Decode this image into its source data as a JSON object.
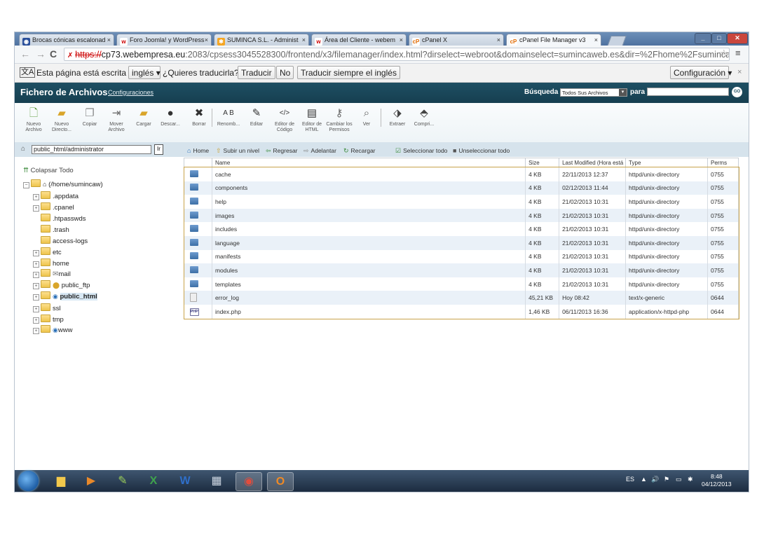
{
  "browser": {
    "tabs": [
      {
        "label": "Brocas cónicas escalonad",
        "favicon": "globe-icon"
      },
      {
        "label": "Foro Joomla! y WordPress",
        "favicon": "webempresa-icon"
      },
      {
        "label": "SUMINCA S.L. - Administ",
        "favicon": "joomla-icon"
      },
      {
        "label": "Área del Cliente - webem",
        "favicon": "webempresa-icon"
      },
      {
        "label": "cPanel X",
        "favicon": "cpanel-icon"
      },
      {
        "label": "cPanel File Manager v3",
        "favicon": "cpanel-icon"
      }
    ],
    "url_scheme": "https://",
    "url_host": "cp73.webempresa.eu",
    "url_rest": ":2083/cpsess3045528300/frontend/x3/filemanager/index.html?dirselect=webroot&domainselect=sumincaweb.es&dir=%2Fhome%2Fsumincaw%2Fpubl"
  },
  "translate": {
    "message": "Esta página está escrita en",
    "language": "inglés",
    "question": "¿Quieres traducirla?",
    "translate_btn": "Traducir",
    "no_btn": "No",
    "always_btn": "Traducir siempre el inglés",
    "settings_btn": "Configuración"
  },
  "cpanel": {
    "title": "Fichero de Archivos",
    "config_link": "Configuraciones",
    "search_label": "Búsqueda",
    "search_scope": "Todos Sus Archivos",
    "for_label": "para",
    "go_label": "GO"
  },
  "toolbar": [
    {
      "label": "Nuevo Archivo",
      "icon": "new-file-icon"
    },
    {
      "label": "Nuevo Directo...",
      "icon": "new-folder-icon"
    },
    {
      "label": "Copiar",
      "icon": "copy-icon"
    },
    {
      "label": "Mover Archivo",
      "icon": "move-file-icon"
    },
    {
      "label": "Cargar",
      "icon": "upload-icon"
    },
    {
      "label": "Descar...",
      "icon": "download-icon"
    },
    {
      "label": "Borrar",
      "icon": "delete-icon"
    },
    {
      "label": "Renomb...",
      "icon": "rename-icon"
    },
    {
      "label": "Editar",
      "icon": "edit-icon"
    },
    {
      "label": "Editor de Código",
      "icon": "code-editor-icon"
    },
    {
      "label": "Editor de HTML",
      "icon": "html-editor-icon"
    },
    {
      "label": "Cambiar los Permisos",
      "icon": "permissions-icon"
    },
    {
      "label": "Ver",
      "icon": "view-icon"
    },
    {
      "label": "Extraer",
      "icon": "extract-icon"
    },
    {
      "label": "Compri...",
      "icon": "compress-icon"
    }
  ],
  "left": {
    "path_value": "public_html/administrator",
    "go_label": "Ir",
    "collapse_label": "Colapsar Todo",
    "tree": [
      {
        "label": "(/home/sumincaw)"
      },
      {
        "label": ".appdata"
      },
      {
        "label": ".cpanel"
      },
      {
        "label": ".htpasswds"
      },
      {
        "label": ".trash"
      },
      {
        "label": "access-logs"
      },
      {
        "label": "etc"
      },
      {
        "label": "home"
      },
      {
        "label": "mail"
      },
      {
        "label": "public_ftp"
      },
      {
        "label": "public_html"
      },
      {
        "label": "ssl"
      },
      {
        "label": "tmp"
      },
      {
        "label": "www"
      }
    ]
  },
  "rightnav": {
    "home": "Home",
    "up": "Subir un nivel",
    "back": "Regresar",
    "forward": "Adelantar",
    "reload": "Recargar",
    "select_all": "Seleccionar todo",
    "unselect_all": "Unseleccionar todo"
  },
  "table": {
    "headers": [
      "Name",
      "Size",
      "Last Modified (Hora está",
      "Type",
      "Perms"
    ],
    "rows": [
      {
        "icon": "folder",
        "name": "cache",
        "size": "4 KB",
        "modified": "22/11/2013 12:37",
        "type": "httpd/unix-directory",
        "perms": "0755"
      },
      {
        "icon": "folder",
        "name": "components",
        "size": "4 KB",
        "modified": "02/12/2013 11:44",
        "type": "httpd/unix-directory",
        "perms": "0755"
      },
      {
        "icon": "folder",
        "name": "help",
        "size": "4 KB",
        "modified": "21/02/2013 10:31",
        "type": "httpd/unix-directory",
        "perms": "0755"
      },
      {
        "icon": "folder",
        "name": "images",
        "size": "4 KB",
        "modified": "21/02/2013 10:31",
        "type": "httpd/unix-directory",
        "perms": "0755"
      },
      {
        "icon": "folder",
        "name": "includes",
        "size": "4 KB",
        "modified": "21/02/2013 10:31",
        "type": "httpd/unix-directory",
        "perms": "0755"
      },
      {
        "icon": "folder",
        "name": "language",
        "size": "4 KB",
        "modified": "21/02/2013 10:31",
        "type": "httpd/unix-directory",
        "perms": "0755"
      },
      {
        "icon": "folder",
        "name": "manifests",
        "size": "4 KB",
        "modified": "21/02/2013 10:31",
        "type": "httpd/unix-directory",
        "perms": "0755"
      },
      {
        "icon": "folder",
        "name": "modules",
        "size": "4 KB",
        "modified": "21/02/2013 10:31",
        "type": "httpd/unix-directory",
        "perms": "0755"
      },
      {
        "icon": "folder",
        "name": "templates",
        "size": "4 KB",
        "modified": "21/02/2013 10:31",
        "type": "httpd/unix-directory",
        "perms": "0755"
      },
      {
        "icon": "text",
        "name": "error_log",
        "size": "45,21 KB",
        "modified": "Hoy 08:42",
        "type": "text/x-generic",
        "perms": "0644"
      },
      {
        "icon": "php",
        "name": "index.php",
        "size": "1,46 KB",
        "modified": "06/11/2013 16:36",
        "type": "application/x-httpd-php",
        "perms": "0644"
      }
    ]
  },
  "taskbar": {
    "lang": "ES",
    "time": "8:48",
    "date": "04/12/2013"
  }
}
